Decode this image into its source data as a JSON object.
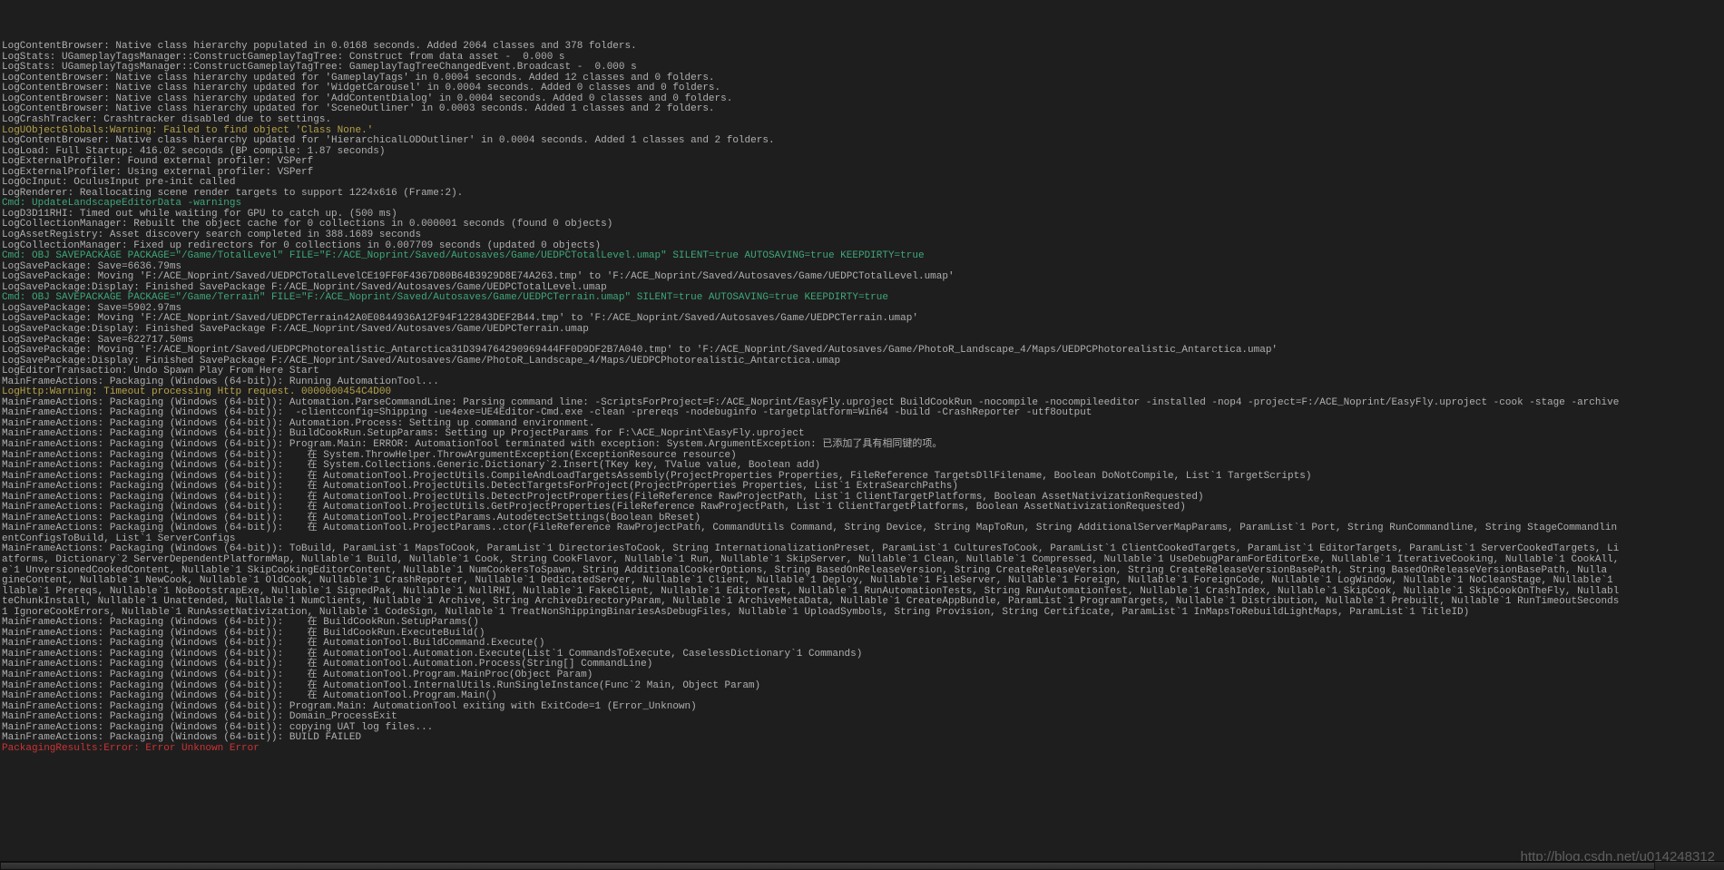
{
  "watermark": "http://blog.csdn.net/u014248312",
  "log": [
    {
      "cls": "normal",
      "text": "LogContentBrowser: Native class hierarchy populated in 0.0168 seconds. Added 2064 classes and 378 folders."
    },
    {
      "cls": "normal",
      "text": "LogStats: UGameplayTagsManager::ConstructGameplayTagTree: Construct from data asset -  0.000 s"
    },
    {
      "cls": "normal",
      "text": "LogStats: UGameplayTagsManager::ConstructGameplayTagTree: GameplayTagTreeChangedEvent.Broadcast -  0.000 s"
    },
    {
      "cls": "normal",
      "text": "LogContentBrowser: Native class hierarchy updated for 'GameplayTags' in 0.0004 seconds. Added 12 classes and 0 folders."
    },
    {
      "cls": "normal",
      "text": "LogContentBrowser: Native class hierarchy updated for 'WidgetCarousel' in 0.0004 seconds. Added 0 classes and 0 folders."
    },
    {
      "cls": "normal",
      "text": "LogContentBrowser: Native class hierarchy updated for 'AddContentDialog' in 0.0004 seconds. Added 0 classes and 0 folders."
    },
    {
      "cls": "normal",
      "text": "LogContentBrowser: Native class hierarchy updated for 'SceneOutliner' in 0.0003 seconds. Added 1 classes and 2 folders."
    },
    {
      "cls": "normal",
      "text": "LogCrashTracker: Crashtracker disabled due to settings."
    },
    {
      "cls": "warn",
      "text": "LogUObjectGlobals:Warning: Failed to find object 'Class None.'"
    },
    {
      "cls": "normal",
      "text": "LogContentBrowser: Native class hierarchy updated for 'HierarchicalLODOutliner' in 0.0004 seconds. Added 1 classes and 2 folders."
    },
    {
      "cls": "normal",
      "text": "LogLoad: Full Startup: 416.02 seconds (BP compile: 1.87 seconds)"
    },
    {
      "cls": "normal",
      "text": "LogExternalProfiler: Found external profiler: VSPerf"
    },
    {
      "cls": "normal",
      "text": "LogExternalProfiler: Using external profiler: VSPerf"
    },
    {
      "cls": "normal",
      "text": "LogOcInput: OculusInput pre-init called"
    },
    {
      "cls": "normal",
      "text": "LogRenderer: Reallocating scene render targets to support 1224x616 (Frame:2)."
    },
    {
      "cls": "cmd",
      "text": "Cmd: UpdateLandscapeEditorData -warnings"
    },
    {
      "cls": "normal",
      "text": "LogD3D11RHI: Timed out while waiting for GPU to catch up. (500 ms)"
    },
    {
      "cls": "normal",
      "text": "LogCollectionManager: Rebuilt the object cache for 0 collections in 0.000001 seconds (found 0 objects)"
    },
    {
      "cls": "normal",
      "text": "LogAssetRegistry: Asset discovery search completed in 388.1689 seconds"
    },
    {
      "cls": "normal",
      "text": "LogCollectionManager: Fixed up redirectors for 0 collections in 0.007709 seconds (updated 0 objects)"
    },
    {
      "cls": "cmd",
      "text": "Cmd: OBJ SAVEPACKAGE PACKAGE=\"/Game/TotalLevel\" FILE=\"F:/ACE_Noprint/Saved/Autosaves/Game/UEDPCTotalLevel.umap\" SILENT=true AUTOSAVING=true KEEPDIRTY=true"
    },
    {
      "cls": "normal",
      "text": "LogSavePackage: Save=6636.79ms"
    },
    {
      "cls": "normal",
      "text": "LogSavePackage: Moving 'F:/ACE_Noprint/Saved/UEDPCTotalLevelCE19FF0F4367D80B64B3929D8E74A263.tmp' to 'F:/ACE_Noprint/Saved/Autosaves/Game/UEDPCTotalLevel.umap'"
    },
    {
      "cls": "normal",
      "text": "LogSavePackage:Display: Finished SavePackage F:/ACE_Noprint/Saved/Autosaves/Game/UEDPCTotalLevel.umap"
    },
    {
      "cls": "cmd",
      "text": "Cmd: OBJ SAVEPACKAGE PACKAGE=\"/Game/Terrain\" FILE=\"F:/ACE_Noprint/Saved/Autosaves/Game/UEDPCTerrain.umap\" SILENT=true AUTOSAVING=true KEEPDIRTY=true"
    },
    {
      "cls": "normal",
      "text": "LogSavePackage: Save=5902.97ms"
    },
    {
      "cls": "normal",
      "text": "LogSavePackage: Moving 'F:/ACE_Noprint/Saved/UEDPCTerrain42A0E0844936A12F94F122843DEF2B44.tmp' to 'F:/ACE_Noprint/Saved/Autosaves/Game/UEDPCTerrain.umap'"
    },
    {
      "cls": "normal",
      "text": "LogSavePackage:Display: Finished SavePackage F:/ACE_Noprint/Saved/Autosaves/Game/UEDPCTerrain.umap"
    },
    {
      "cls": "normal",
      "text": "LogSavePackage: Save=622717.50ms"
    },
    {
      "cls": "normal",
      "text": "LogSavePackage: Moving 'F:/ACE_Noprint/Saved/UEDPCPhotorealistic_Antarctica31D394764290969444FF0D9DF2B7A040.tmp' to 'F:/ACE_Noprint/Saved/Autosaves/Game/PhotoR_Landscape_4/Maps/UEDPCPhotorealistic_Antarctica.umap'"
    },
    {
      "cls": "normal",
      "text": "LogSavePackage:Display: Finished SavePackage F:/ACE_Noprint/Saved/Autosaves/Game/PhotoR_Landscape_4/Maps/UEDPCPhotorealistic_Antarctica.umap"
    },
    {
      "cls": "normal",
      "text": "LogEditorTransaction: Undo Spawn Play From Here Start"
    },
    {
      "cls": "normal",
      "text": "MainFrameActions: Packaging (Windows (64-bit)): Running AutomationTool..."
    },
    {
      "cls": "warn",
      "text": "LogHttp:Warning: Timeout processing Http request. 0000000454C4D00"
    },
    {
      "cls": "normal",
      "text": "MainFrameActions: Packaging (Windows (64-bit)): Automation.ParseCommandLine: Parsing command line: -ScriptsForProject=F:/ACE_Noprint/EasyFly.uproject BuildCookRun -nocompile -nocompileeditor -installed -nop4 -project=F:/ACE_Noprint/EasyFly.uproject -cook -stage -archive"
    },
    {
      "cls": "normal",
      "text": "MainFrameActions: Packaging (Windows (64-bit)):  -clientconfig=Shipping -ue4exe=UE4Editor-Cmd.exe -clean -prereqs -nodebuginfo -targetplatform=Win64 -build -CrashReporter -utf8output"
    },
    {
      "cls": "normal",
      "text": "MainFrameActions: Packaging (Windows (64-bit)): Automation.Process: Setting up command environment."
    },
    {
      "cls": "normal",
      "text": "MainFrameActions: Packaging (Windows (64-bit)): BuildCookRun.SetupParams: Setting up ProjectParams for F:\\ACE_Noprint\\EasyFly.uproject"
    },
    {
      "cls": "normal",
      "text": "MainFrameActions: Packaging (Windows (64-bit)): Program.Main: ERROR: AutomationTool terminated with exception: System.ArgumentException: 已添加了具有相同键的项。",
      "underlineStart": 361,
      "underlineEnd": 506
    },
    {
      "cls": "normal",
      "text": "MainFrameActions: Packaging (Windows (64-bit)):    在 System.ThrowHelper.ThrowArgumentException(ExceptionResource resource)",
      "underlineStart": 345,
      "underlineEnd": 420
    },
    {
      "cls": "normal",
      "text": "MainFrameActions: Packaging (Windows (64-bit)):    在 System.Collections.Generic.Dictionary`2.Insert(TKey key, TValue value, Boolean add)"
    },
    {
      "cls": "normal",
      "text": "MainFrameActions: Packaging (Windows (64-bit)):    在 AutomationTool.ProjectUtils.CompileAndLoadTargetsAssembly(ProjectProperties Properties, FileReference TargetsDllFilename, Boolean DoNotCompile, List`1 TargetScripts)"
    },
    {
      "cls": "normal",
      "text": "MainFrameActions: Packaging (Windows (64-bit)):    在 AutomationTool.ProjectUtils.DetectTargetsForProject(ProjectProperties Properties, List`1 ExtraSearchPaths)"
    },
    {
      "cls": "normal",
      "text": "MainFrameActions: Packaging (Windows (64-bit)):    在 AutomationTool.ProjectUtils.DetectProjectProperties(FileReference RawProjectPath, List`1 ClientTargetPlatforms, Boolean AssetNativizationRequested)"
    },
    {
      "cls": "normal",
      "text": "MainFrameActions: Packaging (Windows (64-bit)):    在 AutomationTool.ProjectUtils.GetProjectProperties(FileReference RawProjectPath, List`1 ClientTargetPlatforms, Boolean AssetNativizationRequested)"
    },
    {
      "cls": "normal",
      "text": "MainFrameActions: Packaging (Windows (64-bit)):    在 AutomationTool.ProjectParams.AutodetectSettings(Boolean bReset)"
    },
    {
      "cls": "normal",
      "text": "MainFrameActions: Packaging (Windows (64-bit)):    在 AutomationTool.ProjectParams..ctor(FileReference RawProjectPath, CommandUtils Command, String Device, String MapToRun, String AdditionalServerMapParams, ParamList`1 Port, String RunCommandline, String StageCommandlin"
    },
    {
      "cls": "normal",
      "text": "entConfigsToBuild, List`1 ServerConfigs"
    },
    {
      "cls": "normal",
      "text": "MainFrameActions: Packaging (Windows (64-bit)): ToBuild, ParamList`1 MapsToCook, ParamList`1 DirectoriesToCook, String InternationalizationPreset, ParamList`1 CulturesToCook, ParamList`1 ClientCookedTargets, ParamList`1 EditorTargets, ParamList`1 ServerCookedTargets, Li"
    },
    {
      "cls": "normal",
      "text": "atforms, Dictionary`2 ServerDependentPlatformMap, Nullable`1 Build, Nullable`1 Cook, String CookFlavor, Nullable`1 Run, Nullable`1 SkipServer, Nullable`1 Clean, Nullable`1 Compressed, Nullable`1 UseDebugParamForEditorExe, Nullable`1 IterativeCooking, Nullable`1 CookAll,"
    },
    {
      "cls": "normal",
      "text": "e`1 UnversionedCookedContent, Nullable`1 SkipCookingEditorContent, Nullable`1 NumCookersToSpawn, String AdditionalCookerOptions, String BasedOnReleaseVersion, String CreateReleaseVersion, String CreateReleaseVersionBasePath, String BasedOnReleaseVersionBasePath, Nulla"
    },
    {
      "cls": "normal",
      "text": "gineContent, Nullable`1 NewCook, Nullable`1 OldCook, Nullable`1 CrashReporter, Nullable`1 DedicatedServer, Nullable`1 Client, Nullable`1 Deploy, Nullable`1 FileServer, Nullable`1 Foreign, Nullable`1 ForeignCode, Nullable`1 LogWindow, Nullable`1 NoCleanStage, Nullable`1"
    },
    {
      "cls": "normal",
      "text": "llable`1 Prereqs, Nullable`1 NoBootstrapExe, Nullable`1 SignedPak, Nullable`1 NullRHI, Nullable`1 FakeClient, Nullable`1 EditorTest, Nullable`1 RunAutomationTests, String RunAutomationTest, Nullable`1 CrashIndex, Nullable`1 SkipCook, Nullable`1 SkipCookOnTheFly, Nullabl"
    },
    {
      "cls": "normal",
      "text": "teChunkInstall, Nullable`1 Unattended, Nullable`1 NumClients, Nullable`1 Archive, String ArchiveDirectoryParam, Nullable`1 ArchiveMetaData, Nullable`1 CreateAppBundle, ParamList`1 ProgramTargets, Nullable`1 Distribution, Nullable`1 Prebuilt, Nullable`1 RunTimeoutSeconds"
    },
    {
      "cls": "normal",
      "text": "1 IgnoreCookErrors, Nullable`1 RunAssetNativization, Nullable`1 CodeSign, Nullable`1 TreatNonShippingBinariesAsDebugFiles, Nullable`1 UploadSymbols, String Provision, String Certificate, ParamList`1 InMapsToRebuildLightMaps, ParamList`1 TitleID)"
    },
    {
      "cls": "normal",
      "text": "MainFrameActions: Packaging (Windows (64-bit)):    在 BuildCookRun.SetupParams()"
    },
    {
      "cls": "normal",
      "text": "MainFrameActions: Packaging (Windows (64-bit)):    在 BuildCookRun.ExecuteBuild()"
    },
    {
      "cls": "normal",
      "text": "MainFrameActions: Packaging (Windows (64-bit)):    在 AutomationTool.BuildCommand.Execute()"
    },
    {
      "cls": "normal",
      "text": "MainFrameActions: Packaging (Windows (64-bit)):    在 AutomationTool.Automation.Execute(List`1 CommandsToExecute, CaselessDictionary`1 Commands)"
    },
    {
      "cls": "normal",
      "text": "MainFrameActions: Packaging (Windows (64-bit)):    在 AutomationTool.Automation.Process(String[] CommandLine)"
    },
    {
      "cls": "normal",
      "text": "MainFrameActions: Packaging (Windows (64-bit)):    在 AutomationTool.Program.MainProc(Object Param)"
    },
    {
      "cls": "normal",
      "text": "MainFrameActions: Packaging (Windows (64-bit)):    在 AutomationTool.InternalUtils.RunSingleInstance(Func`2 Main, Object Param)"
    },
    {
      "cls": "normal",
      "text": "MainFrameActions: Packaging (Windows (64-bit)):    在 AutomationTool.Program.Main()"
    },
    {
      "cls": "normal",
      "text": "MainFrameActions: Packaging (Windows (64-bit)): Program.Main: AutomationTool exiting with ExitCode=1 (Error_Unknown)",
      "underlineStart": 358,
      "underlineEnd": 680
    },
    {
      "cls": "normal",
      "text": "MainFrameActions: Packaging (Windows (64-bit)): Domain_ProcessExit"
    },
    {
      "cls": "normal",
      "text": "MainFrameActions: Packaging (Windows (64-bit)): copying UAT log files..."
    },
    {
      "cls": "normal",
      "text": "MainFrameActions: Packaging (Windows (64-bit)): BUILD FAILED"
    },
    {
      "cls": "error",
      "text": "PackagingResults:Error: Error Unknown Error"
    }
  ]
}
